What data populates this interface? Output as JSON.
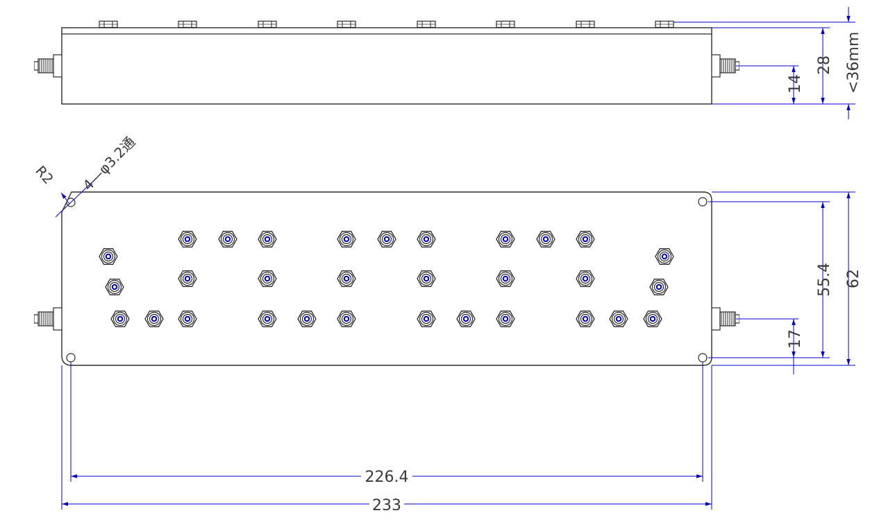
{
  "colors": {
    "outline": "#2b2b2b",
    "dimension": "#0000cc",
    "text": "#3a3a3a",
    "screw_core": "#0000cc"
  },
  "side_view": {
    "screw_count": 8,
    "dimensions": {
      "height_total": "<36mm",
      "body_height": "28",
      "connector_center": "14"
    }
  },
  "top_view": {
    "annotations": {
      "corner_radius": "R2",
      "holes": "4—φ3.2通"
    },
    "dimensions": {
      "hole_spacing_vertical": "55.4",
      "width_total": "62",
      "connector_offset": "17",
      "hole_spacing_horizontal": "226.4",
      "length_total": "233"
    }
  }
}
